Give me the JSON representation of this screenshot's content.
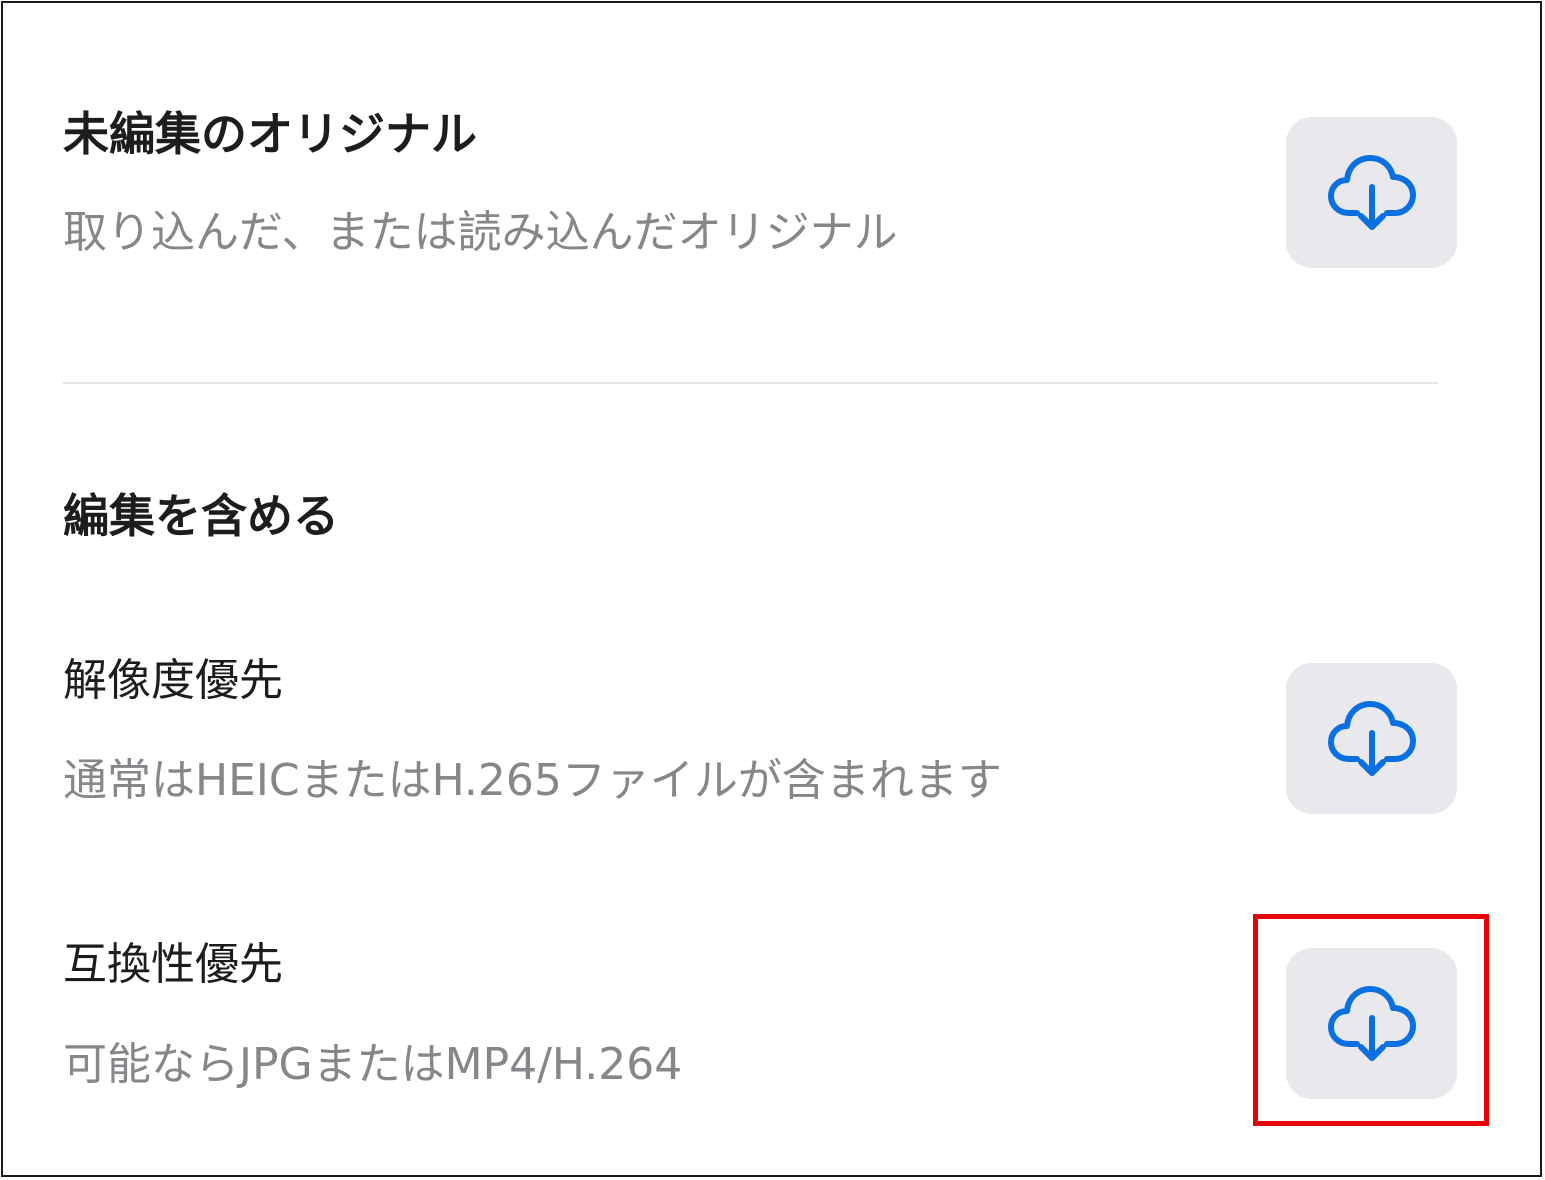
{
  "sections": {
    "original": {
      "title": "未編集のオリジナル",
      "description": "取り込んだ、または読み込んだオリジナル",
      "download_icon": "cloud-download-icon"
    },
    "include_edits": {
      "heading": "編集を含める",
      "resolution": {
        "label": "解像度優先",
        "description": "通常はHEICまたはH.265ファイルが含まれます",
        "download_icon": "cloud-download-icon"
      },
      "compatibility": {
        "label": "互換性優先",
        "description": "可能ならJPGまたはMP4/H.264",
        "download_icon": "cloud-download-icon"
      }
    }
  },
  "colors": {
    "accent": "#0a6fe0",
    "button_bg": "#e8e8ed",
    "highlight": "#e8000b",
    "title": "#1d1d1f",
    "description": "#86868b"
  }
}
